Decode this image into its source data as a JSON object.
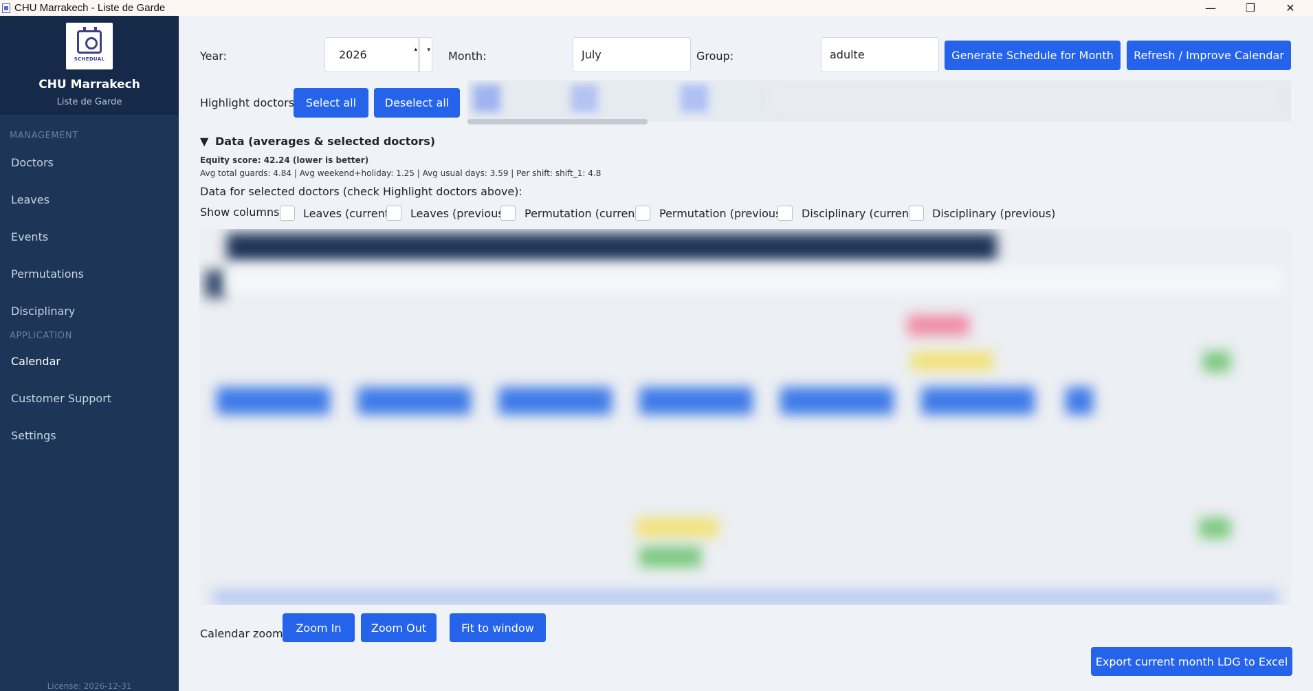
{
  "window": {
    "title": "CHU Marrakech - Liste de Garde",
    "controls": {
      "minimize": "—",
      "restore": "❐",
      "close": "✕"
    }
  },
  "sidebar": {
    "logo_text": "SCHEDUAL",
    "app_name": "CHU Marrakech",
    "app_subtitle": "Liste de Garde",
    "sections": {
      "management": "MANAGEMENT",
      "application": "APPLICATION"
    },
    "management_items": [
      "Doctors",
      "Leaves",
      "Events",
      "Permutations",
      "Disciplinary"
    ],
    "application_items": [
      "Calendar",
      "Customer Support",
      "Settings"
    ],
    "active_item": "Calendar",
    "license": "License: 2026-12-31"
  },
  "controls": {
    "year_label": "Year:",
    "year_value": "2026",
    "month_label": "Month:",
    "month_value": "July",
    "group_label": "Group:",
    "group_value": "adulte",
    "generate_button": "Generate Schedule for Month",
    "refresh_button": "Refresh / Improve Calendar",
    "highlight_label": "Highlight doctors:",
    "select_all": "Select all",
    "deselect_all": "Deselect all"
  },
  "data_section": {
    "toggle_icon": "▼",
    "title": "Data (averages & selected doctors)",
    "equity": "Equity score: 42.24 (lower is better)",
    "averages": "Avg total guards: 4.84 | Avg weekend+holiday: 1.25 | Avg usual days: 3.59 | Per shift: shift_1: 4.8",
    "selected_hint": "Data for selected doctors (check Highlight doctors above):",
    "show_columns_label": "Show columns:",
    "columns": [
      {
        "label": "Leaves (current)",
        "checked": false
      },
      {
        "label": "Leaves (previous)",
        "checked": false
      },
      {
        "label": "Permutation (current)",
        "checked": false
      },
      {
        "label": "Permutation (previous)",
        "checked": false
      },
      {
        "label": "Disciplinary (current)",
        "checked": false
      },
      {
        "label": "Disciplinary (previous)",
        "checked": false
      }
    ]
  },
  "zoom": {
    "label": "Calendar zoom:",
    "zoom_in": "Zoom In",
    "zoom_out": "Zoom Out",
    "fit": "Fit to window"
  },
  "export_button": "Export current month LDG to Excel",
  "colors": {
    "sidebar": "#1d3557",
    "sidebar_brand": "#152a48",
    "accent": "#2563eb",
    "background": "#eff2f7"
  }
}
